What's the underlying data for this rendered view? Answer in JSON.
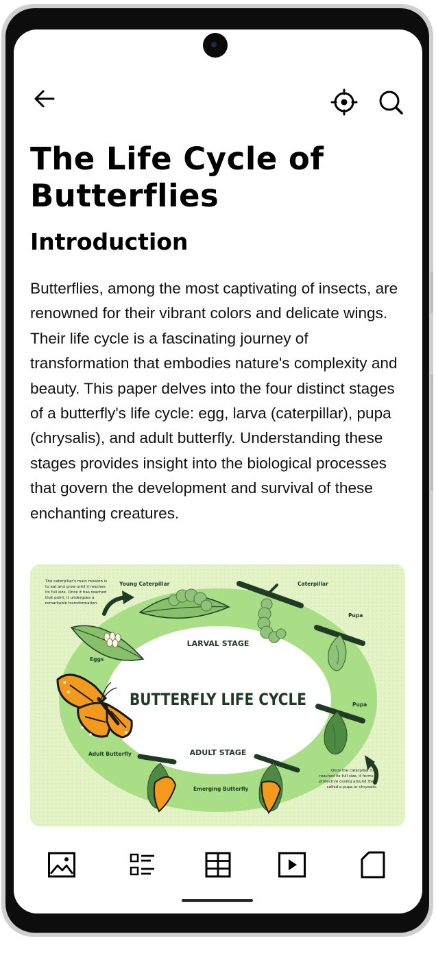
{
  "header": {
    "back_icon": "arrow-left-icon",
    "locate_icon": "crosshair-icon",
    "search_icon": "search-icon"
  },
  "article": {
    "title": "The Life Cycle of Butterflies",
    "section_heading": "Introduction",
    "paragraph": "Butterflies, among the most captivating of insects, are renowned for their vibrant colors and delicate wings. Their life cycle is a fascinating journey of transformation that embodies nature's complexity and beauty. This paper delves into the four distinct stages of a butterfly's life cycle: egg, larva (caterpillar), pupa (chrysalis), and adult butterfly. Understanding these stages provides insight into the biological processes that govern the development and survival of these enchanting creatures."
  },
  "figure": {
    "main_title": "BUTTERFLY LIFE CYCLE",
    "stage_top": "LARVAL STAGE",
    "stage_bottom": "ADULT STAGE",
    "label_young_caterpillar": "Young Caterpillar",
    "label_caterpillar": "Caterpillar",
    "label_pupa_1": "Pupa",
    "label_pupa_2": "Pupa",
    "label_eggs": "Eggs",
    "label_adult": "Adult Butterfly",
    "label_emerging": "Emerging Butterfly",
    "note_top": [
      "The caterpillar's main mission is",
      "to eat and grow until it reaches",
      "its full size. Once it has reached",
      "that point, it undergoes a",
      "remarkable transformation."
    ],
    "note_bottom": [
      "Once the caterpillar has",
      "reached its full size, it forms a",
      "protective casing around itself",
      "called a pupa or chrysalis."
    ],
    "colors": {
      "background": "#e3f3c6",
      "ring": "#a9dd86",
      "dark_green": "#1f3b26",
      "leaf": "#86c06b",
      "orange": "#f39a1e"
    }
  },
  "bottom_nav": {
    "items": [
      "image-icon",
      "list-icon",
      "table-icon",
      "play-icon",
      "page-icon"
    ]
  }
}
